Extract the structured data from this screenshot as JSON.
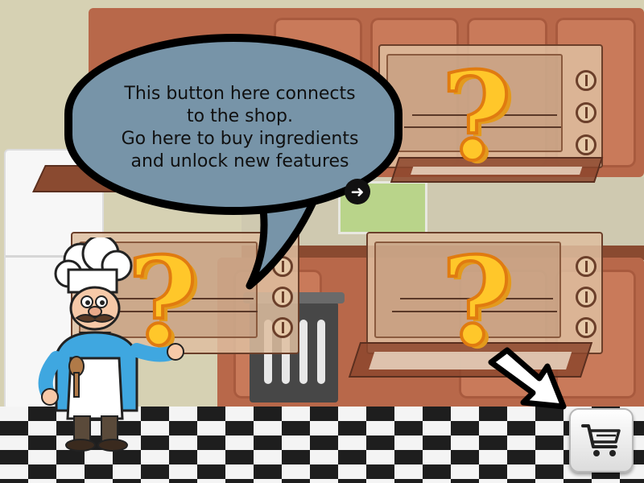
{
  "tutorial": {
    "line1": "This button here connects",
    "line2": "to the shop.",
    "line3": "Go here to buy ingredients",
    "line4": "and unlock new features",
    "next_glyph": "➜"
  },
  "ovens": [
    {
      "state": "locked",
      "glyph": "?"
    },
    {
      "state": "locked",
      "glyph": "?"
    },
    {
      "state": "locked",
      "glyph": "?"
    }
  ],
  "icons": {
    "shop": "shopping-cart-icon",
    "next": "arrow-right-icon",
    "pointer": "pointer-arrow-icon"
  },
  "colors": {
    "bubble": "#7794a8",
    "question_mark": "#ffc72a",
    "cabinet": "#b8684a"
  }
}
